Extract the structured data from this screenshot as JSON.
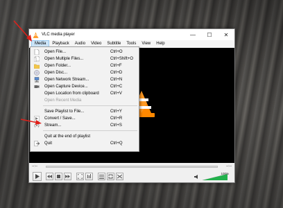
{
  "window": {
    "title": "VLC media player",
    "controls": {
      "minimize": "—",
      "maximize": "☐",
      "close": "✕"
    }
  },
  "menubar": {
    "items": [
      "Media",
      "Playback",
      "Audio",
      "Video",
      "Subtitle",
      "Tools",
      "View",
      "Help"
    ],
    "active": "Media"
  },
  "media_menu": {
    "items": [
      {
        "label": "Open File...",
        "shortcut": "Ctrl+O",
        "icon": "file-icon"
      },
      {
        "label": "Open Multiple Files...",
        "shortcut": "Ctrl+Shift+O",
        "icon": "files-icon"
      },
      {
        "label": "Open Folder...",
        "shortcut": "Ctrl+F",
        "icon": "folder-icon"
      },
      {
        "label": "Open Disc...",
        "shortcut": "Ctrl+D",
        "icon": "disc-icon"
      },
      {
        "label": "Open Network Stream...",
        "shortcut": "Ctrl+N",
        "icon": "network-icon"
      },
      {
        "label": "Open Capture Device...",
        "shortcut": "Ctrl+C",
        "icon": "capture-icon"
      },
      {
        "label": "Open Location from clipboard",
        "shortcut": "Ctrl+V",
        "icon": ""
      },
      {
        "label": "Open Recent Media",
        "shortcut": "",
        "icon": "",
        "disabled": true,
        "submenu": true
      },
      {
        "label": "Save Playlist to File...",
        "shortcut": "Ctrl+Y",
        "icon": ""
      },
      {
        "label": "Convert / Save...",
        "shortcut": "Ctrl+R",
        "icon": "convert-icon"
      },
      {
        "label": "Stream...",
        "shortcut": "Ctrl+S",
        "icon": "stream-icon"
      },
      {
        "label": "Quit at the end of playlist",
        "shortcut": "",
        "icon": ""
      },
      {
        "label": "Quit",
        "shortcut": "Ctrl+Q",
        "icon": "quit-icon"
      }
    ]
  },
  "player": {
    "time_elapsed": "--:--",
    "time_total": "--:--",
    "volume_label": "100%",
    "volume_level": 1.0
  },
  "colors": {
    "accent": "#ff8800",
    "menu_highlight": "#cce4f7",
    "annotation_arrow": "#e0201a",
    "volume_green": "#22b14c"
  }
}
